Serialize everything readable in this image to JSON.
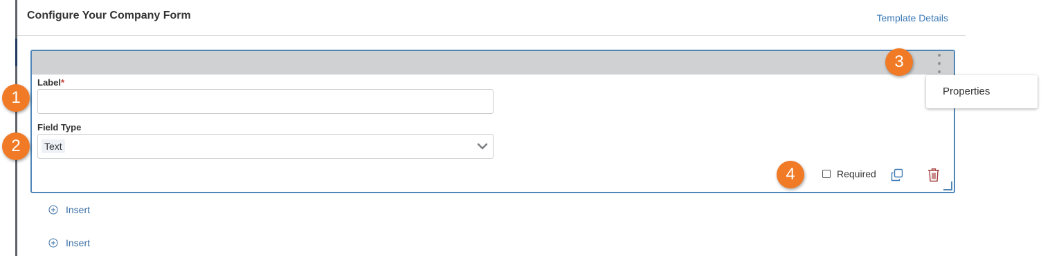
{
  "header": {
    "title": "Configure Your Company Form",
    "template_link": "Template Details"
  },
  "field_card": {
    "label_title": "Label",
    "label_required_marker": "*",
    "label_value": "",
    "field_type_title": "Field Type",
    "field_type_value": "Text",
    "required_label": "Required",
    "required_checked": false
  },
  "menu": {
    "items": [
      {
        "label": "Properties"
      }
    ]
  },
  "inserts": [
    {
      "label": "Insert"
    },
    {
      "label": "Insert"
    }
  ],
  "badges": [
    "1",
    "2",
    "3",
    "4"
  ],
  "colors": {
    "accent_blue": "#4f86b8",
    "link_blue": "#3a78b5",
    "badge_orange": "#f07a25",
    "delete_red": "#a43c3c",
    "card_header_gray": "#cfd1d3"
  },
  "icons": {
    "kebab": "more-vertical-icon",
    "chevron": "chevron-down-icon",
    "copy": "copy-icon",
    "delete": "trash-icon",
    "insert": "plus-circle-icon",
    "resize": "resize-handle-icon"
  }
}
